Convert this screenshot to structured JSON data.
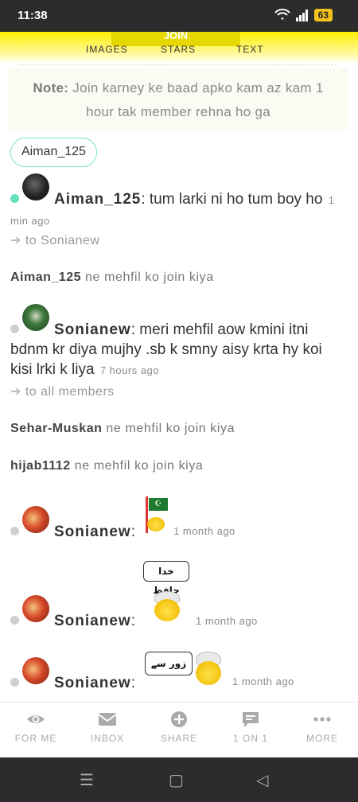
{
  "status_bar": {
    "time": "11:38",
    "battery": "63"
  },
  "header": {
    "join_label": "JOIN",
    "tabs": [
      {
        "label": "IMAGES"
      },
      {
        "label": "STARS"
      },
      {
        "label": "TEXT"
      }
    ]
  },
  "note": {
    "label": "Note:",
    "text": " Join karney ke baad apko kam az kam 1 hour tak member rehna ho ga"
  },
  "filter_chip": {
    "label": "Aiman_125"
  },
  "messages": [
    {
      "user": "Aiman_125",
      "text": ": tum larki ni ho tum boy ho",
      "time": "1 min ago",
      "to": "to Sonianew"
    },
    {
      "user": "Sonianew",
      "text": ": meri mehfil aow kmini itni bdnm kr diya mujhy .sb k smny aisy krta hy koi kisi lrki k liya",
      "time": "7 hours ago",
      "to": "to all members"
    },
    {
      "user": "Sonianew",
      "text": ":",
      "time": "1 month ago"
    },
    {
      "user": "Sonianew",
      "text": ":",
      "time": "1 month ago"
    },
    {
      "user": "Sonianew",
      "text": ":",
      "time": "1 month ago"
    }
  ],
  "system_messages": [
    {
      "user": "Aiman_125",
      "text": " ne mehfil ko join kiya"
    },
    {
      "user": "Sehar-Muskan",
      "text": " ne mehfil ko join kiya"
    },
    {
      "user": "hijab1112",
      "text": " ne mehfil ko join kiya"
    }
  ],
  "stickers": {
    "khuda_hafiz": "خدا حافظ",
    "zor_se": "زور سے"
  },
  "bottom_nav": [
    {
      "label": "FOR ME",
      "icon": "eye-icon"
    },
    {
      "label": "INBOX",
      "icon": "envelope-icon"
    },
    {
      "label": "SHARE",
      "icon": "plus-circle-icon"
    },
    {
      "label": "1 ON 1",
      "icon": "chat-bubble-icon"
    },
    {
      "label": "MORE",
      "icon": "more-dots-icon"
    }
  ],
  "colors": {
    "accent_yellow": "#ffee00",
    "online_dot": "#66dfbf",
    "chip_border": "#7be0d4"
  }
}
